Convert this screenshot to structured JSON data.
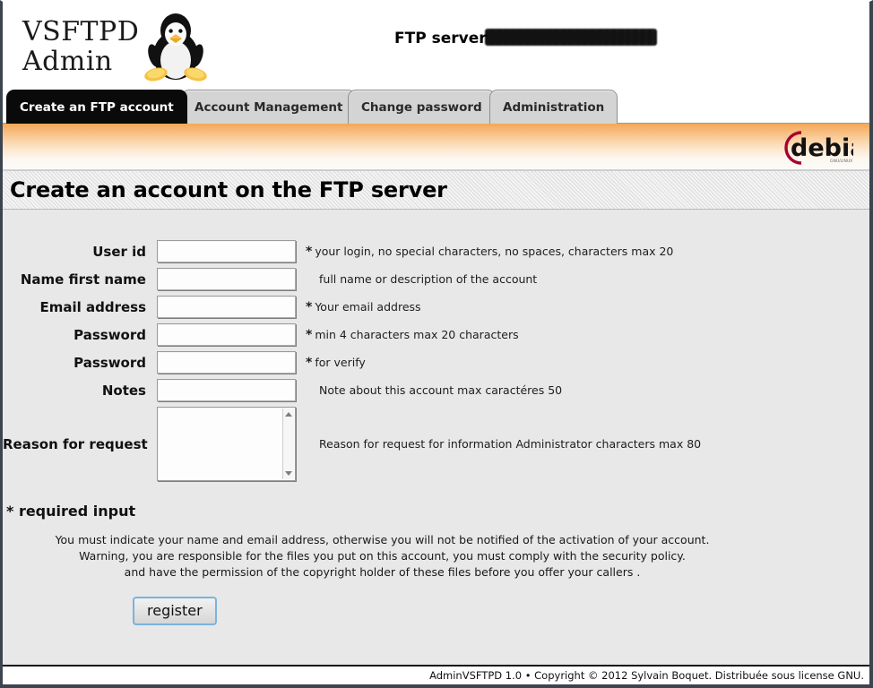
{
  "app": {
    "logo_line1": "VSFTPD",
    "logo_line2": "Admin",
    "logo_icon": "tux-penguin-icon",
    "server_label": "FTP server",
    "server_value_redacted": true,
    "brand_icon": "debian-logo",
    "accent_color": "#f3a858",
    "active_tab_color": "#0a0a0a",
    "button_border_color": "#79b3dd"
  },
  "tabs": [
    {
      "label": "Create an FTP account",
      "active": true
    },
    {
      "label": "Account Management",
      "active": false
    },
    {
      "label": "Change password",
      "active": false
    },
    {
      "label": "Administration",
      "active": false
    }
  ],
  "page": {
    "title": "Create an account on the FTP server"
  },
  "form": {
    "fields": [
      {
        "label": "User id",
        "value": "",
        "required": true,
        "hint": "your login, no special characters, no spaces, characters max 20",
        "type": "text"
      },
      {
        "label": "Name first name",
        "value": "",
        "required": false,
        "hint": "full name or description of the account",
        "type": "text"
      },
      {
        "label": "Email address",
        "value": "",
        "required": true,
        "hint": "Your email address",
        "type": "text"
      },
      {
        "label": "Password",
        "value": "",
        "required": true,
        "hint": "min 4 characters max 20 characters",
        "type": "password"
      },
      {
        "label": "Password",
        "value": "",
        "required": true,
        "hint": "for verify",
        "type": "password"
      },
      {
        "label": "Notes",
        "value": "",
        "required": false,
        "hint": "Note about this account max caractéres 50",
        "type": "text"
      }
    ],
    "textarea": {
      "label": "Reason for request",
      "value": "",
      "hint": "Reason for request for information Administrator characters max 80"
    },
    "required_note": "* required input",
    "warning_lines": [
      "You must indicate your name and email address, otherwise you will not be notified of the activation of your account.",
      "Warning, you are responsible for the files you put on this account, you must comply with the security policy.",
      "and have the permission of the copyright holder of these files before you offer your callers ."
    ],
    "submit_label": "register"
  },
  "footer": {
    "text": "AdminVSFTPD 1.0 • Copyright © 2012 Sylvain Boquet. Distribuée sous license GNU."
  }
}
